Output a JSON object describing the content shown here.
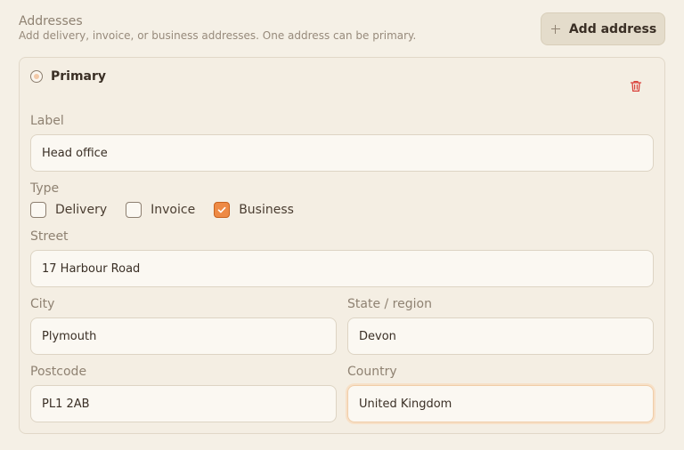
{
  "section": {
    "title": "Addresses",
    "subtitle": "Add delivery, invoice, or business addresses. One address can be primary."
  },
  "add_button": {
    "label": "Add address",
    "icon": "plus-icon"
  },
  "address": {
    "primary_label": "Primary",
    "primary_selected": false,
    "delete_icon": "trash-icon",
    "label_field": {
      "label": "Label",
      "value": "Head office"
    },
    "type": {
      "label": "Type",
      "options": [
        {
          "label": "Delivery",
          "checked": false
        },
        {
          "label": "Invoice",
          "checked": false
        },
        {
          "label": "Business",
          "checked": true
        }
      ]
    },
    "street": {
      "label": "Street",
      "value": "17 Harbour Road"
    },
    "city": {
      "label": "City",
      "value": "Plymouth"
    },
    "state": {
      "label": "State / region",
      "value": "Devon"
    },
    "postcode": {
      "label": "Postcode",
      "value": "PL1 2AB"
    },
    "country": {
      "label": "Country",
      "value": "United Kingdom"
    }
  },
  "colors": {
    "background": "#f5f0e6",
    "accent": "#ee8a45",
    "delete": "#d9413b"
  }
}
